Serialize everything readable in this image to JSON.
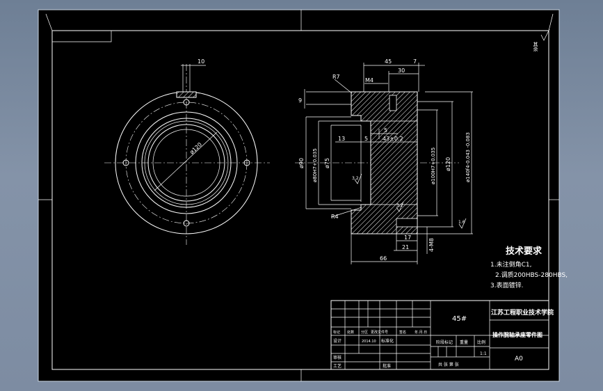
{
  "colors": {
    "background": "#7d8ca2",
    "sheet": "#000000",
    "line": "#ffffff"
  },
  "roughness": {
    "top_right": "其余"
  },
  "left_view": {
    "dim_top": "10",
    "dim_diameter": "ø120"
  },
  "section_view": {
    "dim_45": "45",
    "dim_7": "7",
    "dim_30": "30",
    "label_m4": "M4",
    "label_r7": "R7",
    "dim_9": "9",
    "dim_13": "13",
    "dim_5a": "5",
    "dim_5b": "5",
    "dim_43": "43±0.2",
    "dim_d90": "ø90",
    "dim_d80": "ø80H7+0.035",
    "dim_d75": "ø75",
    "dim_d100": "ø100H7+0.035",
    "dim_d120": "ø120",
    "dim_d140": "ø140f4-0.043 -0.083",
    "label_r4": "R4",
    "dim_17": "17",
    "dim_21": "21",
    "dim_m8": "4-M8",
    "dim_66": "66",
    "rough_1": "3.2",
    "rough_2": "3.2",
    "rough_3": "1.6"
  },
  "tech_req": {
    "title": "技术要求",
    "items": [
      "1.未注倒角C1,",
      "2.调质200HBS-280HBS,",
      "3.表面镀锌."
    ]
  },
  "title_block": {
    "material": "45#",
    "school": "江苏工程职业技术学院",
    "drawing_name": "操作腕轴承座零件图",
    "row_labels": [
      "标记",
      "处数",
      "分区",
      "更改文件号",
      "签名",
      "年.月.日"
    ],
    "designer": "设计",
    "date": "2014.10",
    "standard": "标准化",
    "stage": "阶段标记",
    "weight": "重量",
    "scale": "比例",
    "scale_value": "1:1",
    "check": "审核",
    "process": "工艺",
    "approve": "批准",
    "sheets": "共 张 第 张",
    "size": "A0"
  }
}
